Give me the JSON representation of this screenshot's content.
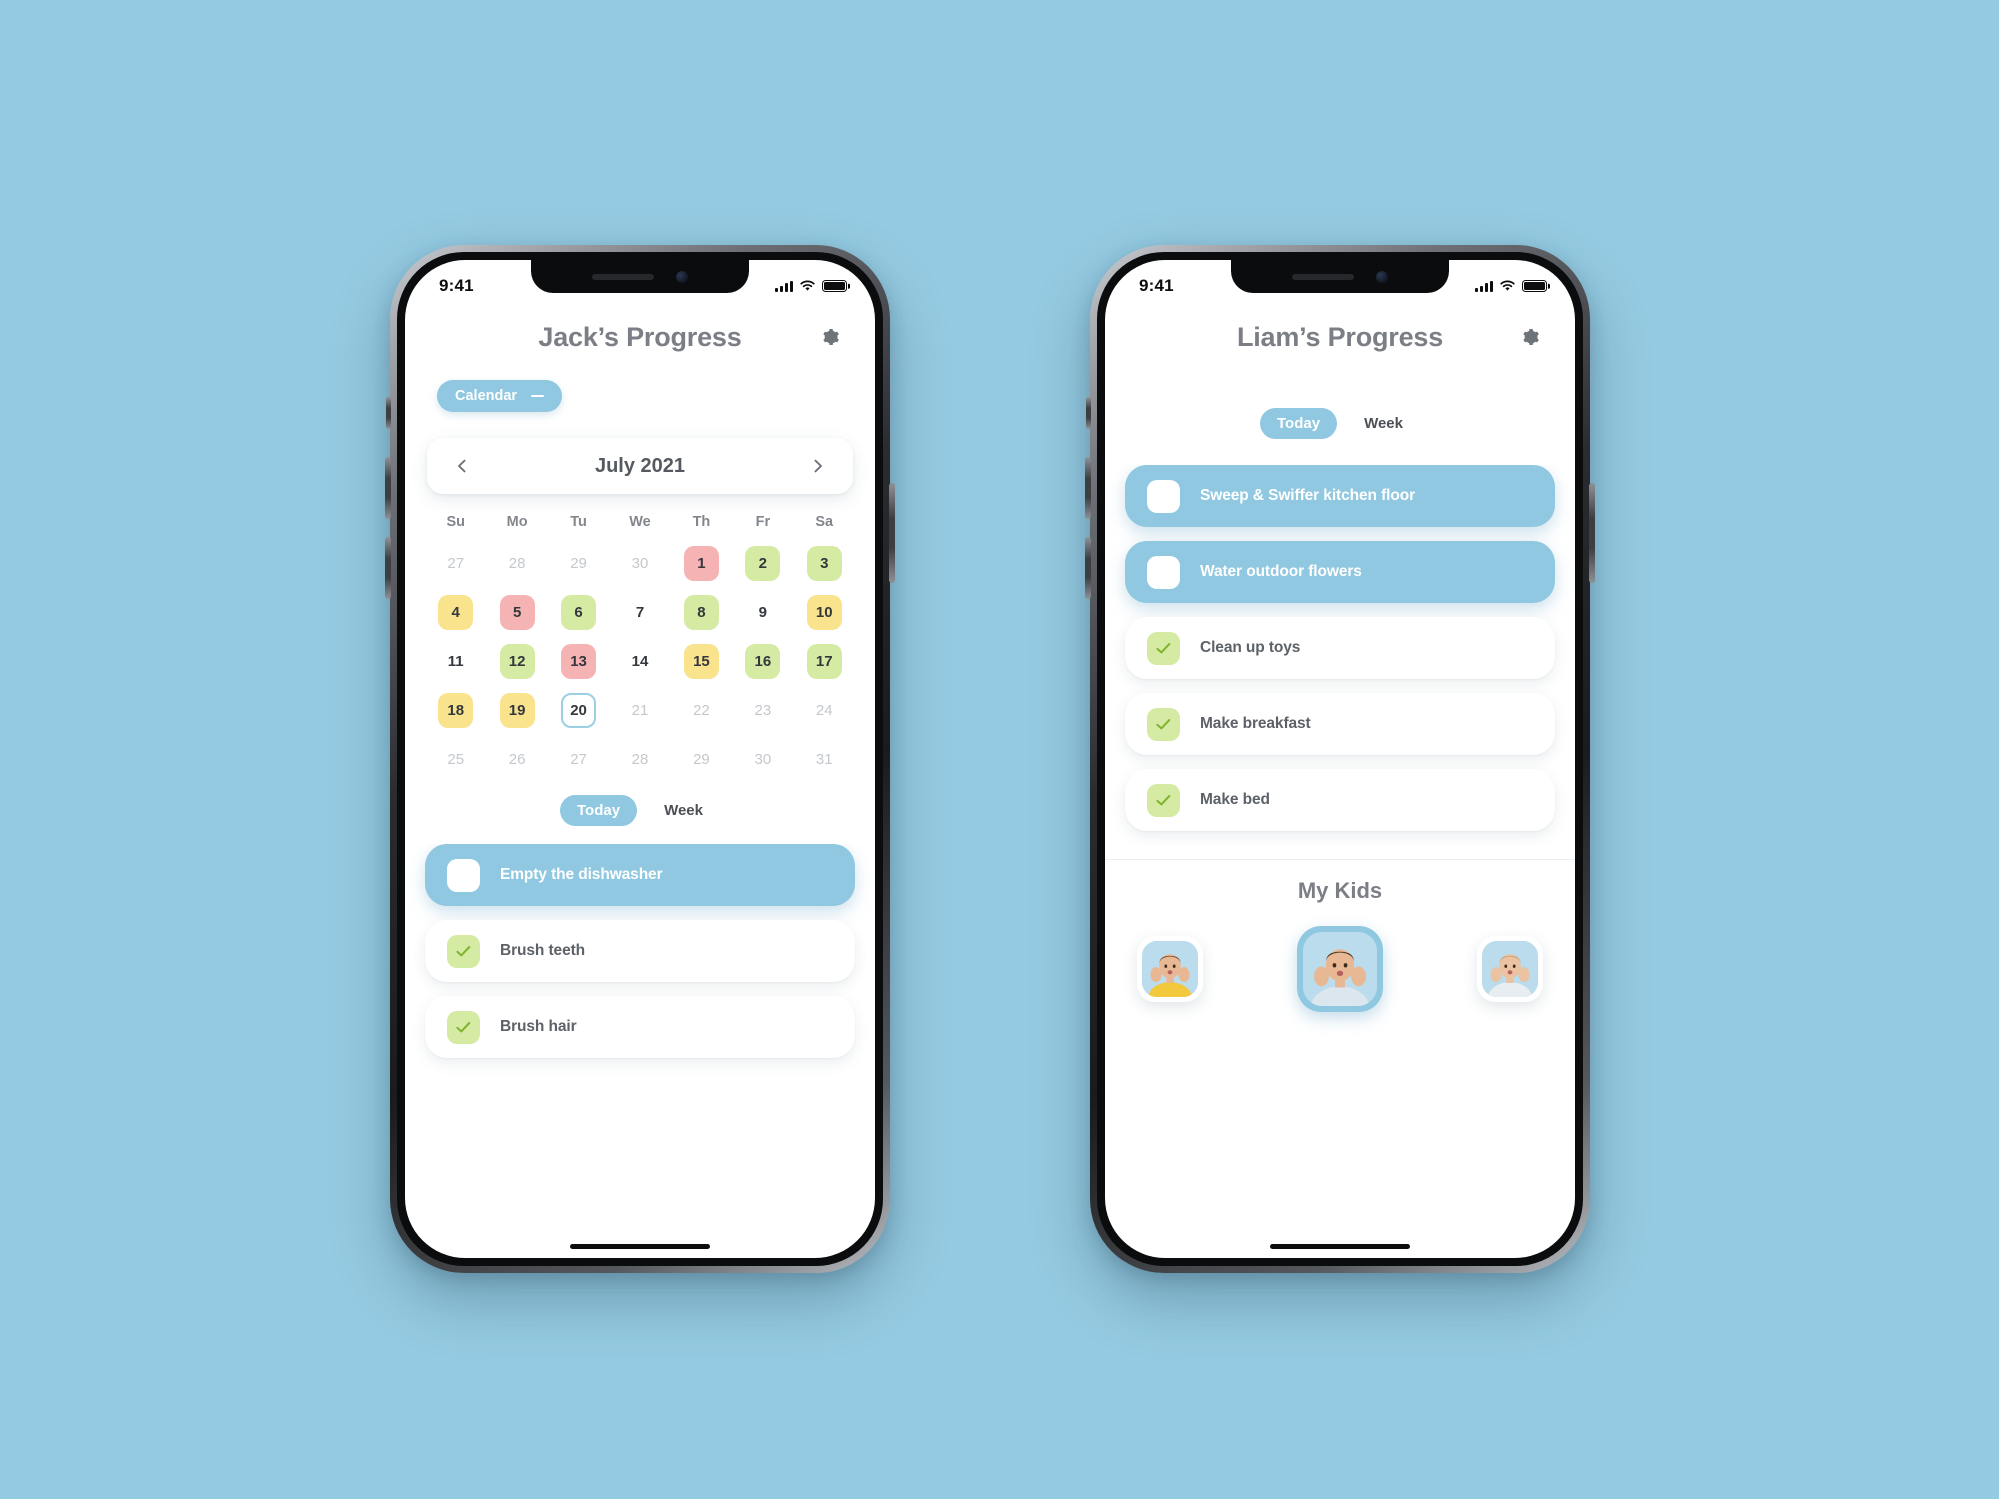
{
  "background_color": "#95CBE2",
  "accent_color": "#8FC8E0",
  "status_bar": {
    "time": "9:41"
  },
  "phone_left": {
    "header": {
      "title": "Jack’s Progress",
      "settings_icon": "gear-icon"
    },
    "calendar_pill": {
      "label": "Calendar",
      "collapse_icon": "minus-icon"
    },
    "month_nav": {
      "prev_icon": "chevron-left-icon",
      "label": "July 2021",
      "next_icon": "chevron-right-icon"
    },
    "calendar": {
      "weekday_headers": [
        "Su",
        "Mo",
        "Tu",
        "We",
        "Th",
        "Fr",
        "Sa"
      ],
      "weeks": [
        [
          {
            "day": "27",
            "state": "muted"
          },
          {
            "day": "28",
            "state": "muted"
          },
          {
            "day": "29",
            "state": "muted"
          },
          {
            "day": "30",
            "state": "muted"
          },
          {
            "day": "1",
            "state": "red"
          },
          {
            "day": "2",
            "state": "green"
          },
          {
            "day": "3",
            "state": "green"
          }
        ],
        [
          {
            "day": "4",
            "state": "yellow"
          },
          {
            "day": "5",
            "state": "red"
          },
          {
            "day": "6",
            "state": "green"
          },
          {
            "day": "7",
            "state": "plain"
          },
          {
            "day": "8",
            "state": "green"
          },
          {
            "day": "9",
            "state": "plain"
          },
          {
            "day": "10",
            "state": "yellow"
          }
        ],
        [
          {
            "day": "11",
            "state": "plain"
          },
          {
            "day": "12",
            "state": "green"
          },
          {
            "day": "13",
            "state": "red"
          },
          {
            "day": "14",
            "state": "plain"
          },
          {
            "day": "15",
            "state": "yellow"
          },
          {
            "day": "16",
            "state": "green"
          },
          {
            "day": "17",
            "state": "green"
          }
        ],
        [
          {
            "day": "18",
            "state": "yellow"
          },
          {
            "day": "19",
            "state": "yellow"
          },
          {
            "day": "20",
            "state": "today"
          },
          {
            "day": "21",
            "state": "muted"
          },
          {
            "day": "22",
            "state": "muted"
          },
          {
            "day": "23",
            "state": "muted"
          },
          {
            "day": "24",
            "state": "muted"
          }
        ],
        [
          {
            "day": "25",
            "state": "muted"
          },
          {
            "day": "26",
            "state": "muted"
          },
          {
            "day": "27",
            "state": "muted"
          },
          {
            "day": "28",
            "state": "muted"
          },
          {
            "day": "29",
            "state": "muted"
          },
          {
            "day": "30",
            "state": "muted"
          },
          {
            "day": "31",
            "state": "muted"
          }
        ]
      ],
      "legend_colors": {
        "green": "#D5EBA4",
        "yellow": "#F9E38D",
        "red": "#F6B3B4",
        "today_border": "#9ACFE4"
      }
    },
    "segmented": {
      "options": [
        "Today",
        "Week"
      ],
      "selected": "Today"
    },
    "tasks": [
      {
        "label": "Empty the dishwasher",
        "state": "pending"
      },
      {
        "label": "Brush teeth",
        "state": "done"
      },
      {
        "label": "Brush hair",
        "state": "done"
      }
    ]
  },
  "phone_right": {
    "header": {
      "title": "Liam’s Progress",
      "settings_icon": "gear-icon"
    },
    "segmented": {
      "options": [
        "Today",
        "Week"
      ],
      "selected": "Today"
    },
    "tasks": [
      {
        "label": "Sweep & Swiffer kitchen floor",
        "state": "pending"
      },
      {
        "label": "Water outdoor flowers",
        "state": "pending"
      },
      {
        "label": "Clean up toys",
        "state": "done"
      },
      {
        "label": "Make breakfast",
        "state": "done"
      },
      {
        "label": "Make bed",
        "state": "done"
      }
    ],
    "kids_section": {
      "title": "My Kids",
      "kids": [
        {
          "name": "kid-1",
          "selected": false,
          "shirt_color": "#F2C83C",
          "skin": "#E8B894",
          "hair": "#6E4A2E"
        },
        {
          "name": "kid-2",
          "selected": true,
          "shirt_color": "#DCE6EE",
          "skin": "#E8B894",
          "hair": "#4A3524"
        },
        {
          "name": "kid-3",
          "selected": false,
          "shirt_color": "#E8EDF2",
          "skin": "#EBC2A2",
          "hair": "#C9A06A"
        }
      ]
    }
  }
}
